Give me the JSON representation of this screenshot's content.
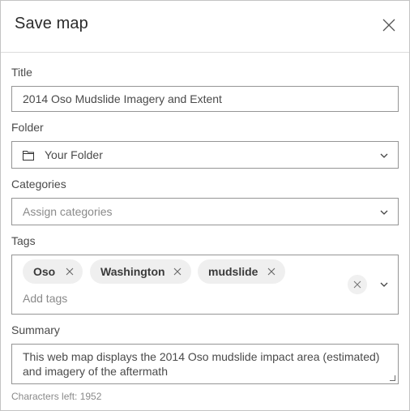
{
  "dialog": {
    "title": "Save map",
    "close_icon": "close-icon"
  },
  "fields": {
    "title": {
      "label": "Title",
      "value": "2014 Oso Mudslide Imagery and Extent"
    },
    "folder": {
      "label": "Folder",
      "icon": "folder-icon",
      "value": "Your Folder",
      "dropdown_icon": "chevron-down-icon"
    },
    "categories": {
      "label": "Categories",
      "placeholder": "Assign categories",
      "dropdown_icon": "chevron-down-icon"
    },
    "tags": {
      "label": "Tags",
      "chips": [
        {
          "label": "Oso"
        },
        {
          "label": "Washington"
        },
        {
          "label": "mudslide"
        }
      ],
      "placeholder": "Add tags",
      "clear_icon": "close-icon",
      "dropdown_icon": "chevron-down-icon"
    },
    "summary": {
      "label": "Summary",
      "value": "This web map displays the 2014 Oso mudslide impact area (estimated) and imagery of the aftermath",
      "characters_left_label": "Characters left: 1952"
    }
  }
}
